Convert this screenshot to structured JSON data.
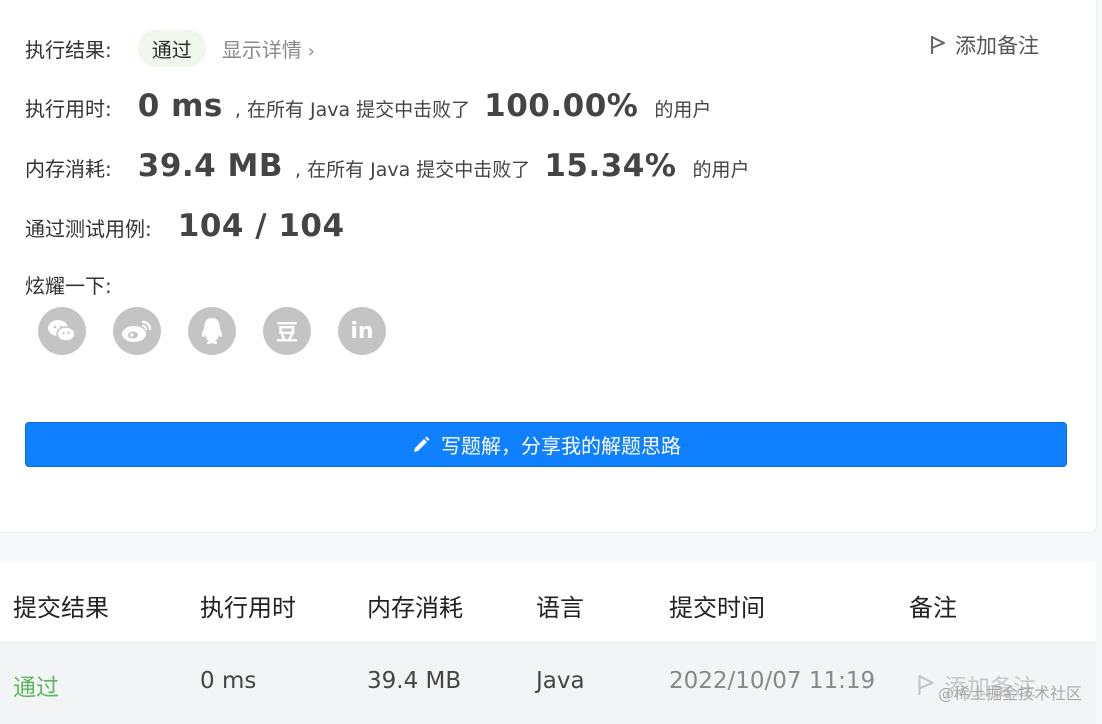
{
  "result": {
    "label": "执行结果:",
    "status": "通过",
    "details_link": "显示详情",
    "chevron": "›",
    "add_note": "添加备注"
  },
  "runtime": {
    "label": "执行用时:",
    "value": "0 ms",
    "mid_text": ", 在所有 Java 提交中击败了",
    "percent": "100.00%",
    "suffix": "的用户"
  },
  "memory": {
    "label": "内存消耗:",
    "value": "39.4 MB",
    "mid_text": ", 在所有 Java 提交中击败了",
    "percent": "15.34%",
    "suffix": "的用户"
  },
  "tests": {
    "label": "通过测试用例:",
    "value": "104 / 104"
  },
  "share": {
    "label": "炫耀一下:",
    "icons": [
      "wechat-icon",
      "weibo-icon",
      "qq-icon",
      "douban-icon",
      "linkedin-icon"
    ],
    "douban_glyph": "豆",
    "linkedin_glyph": "in"
  },
  "write_solution": {
    "label": "写题解，分享我的解题思路"
  },
  "table": {
    "headers": [
      "提交结果",
      "执行用时",
      "内存消耗",
      "语言",
      "提交时间",
      "备注"
    ],
    "rows": [
      {
        "result": "通过",
        "runtime": "0 ms",
        "memory": "39.4 MB",
        "language": "Java",
        "time": "2022/10/07 11:19",
        "note": "添加备注"
      }
    ]
  },
  "watermark": "@稀土掘金技术社区",
  "colors": {
    "primary": "#0f80ff",
    "success": "#5cb85c",
    "badge_bg": "#f0f7ec",
    "icon_gray": "#c4c4c4"
  }
}
